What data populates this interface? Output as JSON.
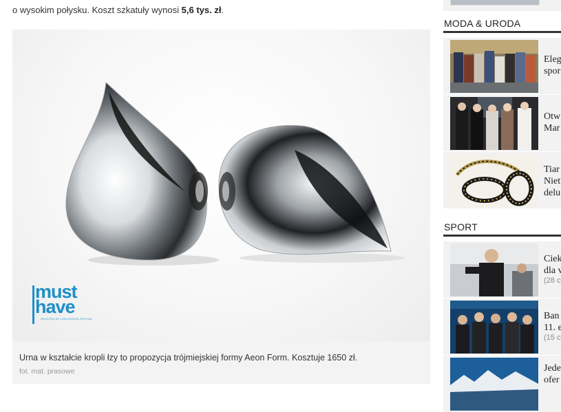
{
  "article": {
    "intro_cut": "...",
    "intro_prefix": "o wysokim połysku. Koszt szkatuły wynosi ",
    "intro_price": "5,6 tys. zł",
    "intro_suffix": "."
  },
  "photo": {
    "logo_line1": "must",
    "logo_line2": "have",
    "logo_tagline": "SELECTED BY LODZ DESIGN FESTIVAL",
    "caption": "Urna w kształcie kropli łzy to propozycja trójmiejskiej formy Aeon Form. Kosztuje 1650 zł.",
    "credit": "fot. mat. prasowe"
  },
  "sidebar": {
    "sections": [
      {
        "title": "MODA & URODA",
        "items": [
          {
            "line1": "Eleg",
            "line2": "spor",
            "meta": ""
          },
          {
            "line1": "Otw",
            "line2": "Mar",
            "meta": ""
          },
          {
            "line1": "Tiar",
            "line2": "Niet",
            "line3": "delu",
            "meta": ""
          }
        ]
      },
      {
        "title": "SPORT",
        "items": [
          {
            "line1": "Ciek",
            "line2": "dla v",
            "meta": "(28 c"
          },
          {
            "line1": "Ban",
            "line2": "11. e",
            "meta": "(15 c"
          },
          {
            "line1": "Jede",
            "line2": "ofer",
            "meta": ""
          }
        ]
      }
    ]
  },
  "colors": {
    "logo_blue": "#1e8fc7",
    "section_rule": "#333333",
    "card_bg": "#f2f2f2"
  }
}
